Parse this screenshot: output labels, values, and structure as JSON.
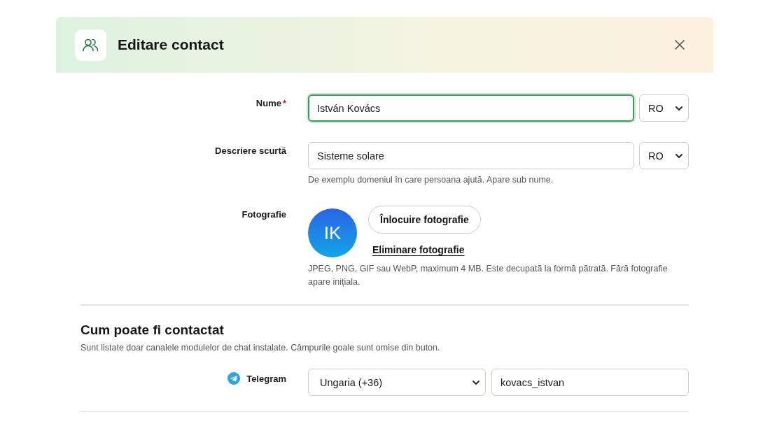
{
  "dialog": {
    "title": "Editare contact"
  },
  "fields": [
    {
      "kind": "text",
      "label": "Nume",
      "required_mark": "*",
      "value": "István Kovács",
      "focused": true,
      "language": "RO"
    },
    {
      "kind": "text",
      "label": "Descriere scurtă",
      "value": "Sisteme solare",
      "focused": false,
      "language": "RO",
      "hint": "De exemplu domeniul în care persoana ajută. Apare sub nume."
    },
    {
      "kind": "photo",
      "label": "Fotografie",
      "initials": "IK",
      "replace_button": "Înlocuire fotografie",
      "remove_link": "Eliminare fotografie",
      "hint": "JPEG, PNG, GIF sau WebP, maximum 4 MB. Este decupată la formă pătrată. Fără fotografie apare inițiala."
    }
  ],
  "contact_section": {
    "title": "Cum poate fi contactat",
    "description": "Sunt listate doar canalele modulelor de chat instalate. Câmpurile goale sunt omise din buton.",
    "channels": [
      {
        "name": "Telegram",
        "country": "Ungaria (+36)",
        "value": "kovacs_istvan"
      }
    ]
  }
}
